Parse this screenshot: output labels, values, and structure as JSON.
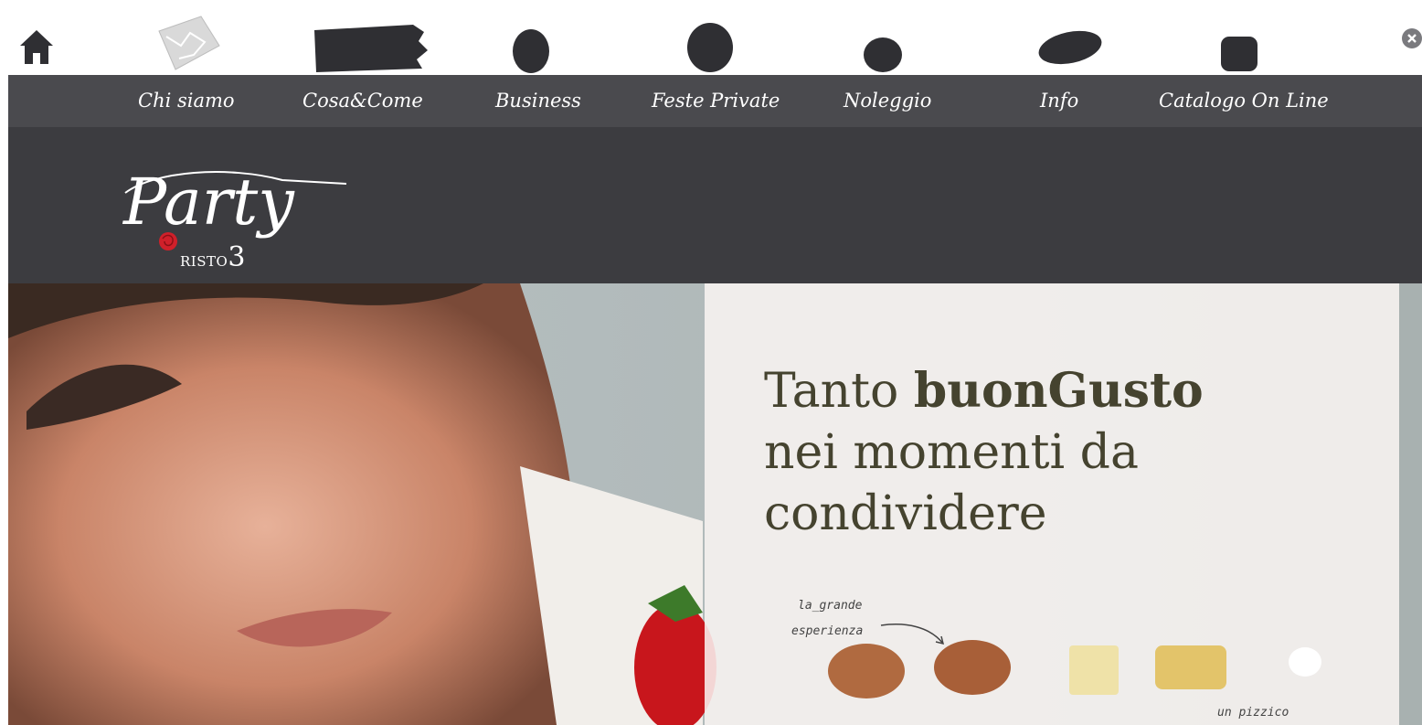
{
  "nav": {
    "items": [
      {
        "label": "Chi siamo"
      },
      {
        "label": "Cosa&Come"
      },
      {
        "label": "Business"
      },
      {
        "label": "Feste Private"
      },
      {
        "label": "Noleggio"
      },
      {
        "label": "Info"
      },
      {
        "label": "Catalogo On Line"
      }
    ]
  },
  "logo": {
    "script_text": "Party",
    "brand_text": "RISTO",
    "brand_number": "3"
  },
  "hero": {
    "headline_part1": "Tanto ",
    "headline_bold": "buonGusto",
    "headline_line2": "nei momenti da",
    "headline_line3": "condividere",
    "note_1a": "la_grande",
    "note_1b": "esperienza",
    "note_2": "un pizzico"
  },
  "icons": {
    "home": "home-icon",
    "close": "close-icon"
  },
  "colors": {
    "navbar": "#4a4a4e",
    "logo_band": "#3c3c40",
    "headline": "#45432f",
    "accent_red": "#d0202a"
  }
}
